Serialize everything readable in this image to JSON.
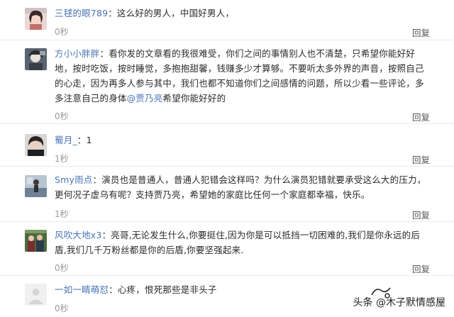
{
  "comments": [
    {
      "username": "三毬的眼789",
      "colon": "：",
      "text": "这么好的男人，中国好男人，",
      "time": "0秒",
      "reply": "回复",
      "avatar_icon": "avatar-girl-icon"
    },
    {
      "username": "方小小胖胖",
      "colon": "：",
      "text": "看你发的文章看的我很难受，你们之间的事情别人也不清楚，只希望你能好好地，按时吃饭，按时睡觉，多抱抱甜馨，钱赚多少才算够。不要听太多外界的声音，按照自己的心走，因为再多人参与其中，我们也都不知道你们之间感情的问题，所以少看一些评论，多多注意自己的身体",
      "mention": "@贾乃亮",
      "text_after": "希望你能好好的",
      "time": "0秒",
      "reply": "回复",
      "avatar_icon": "avatar-anime-icon"
    },
    {
      "username": "蜀月_",
      "colon": "：",
      "text": "1",
      "time": "1秒",
      "reply": "回复",
      "avatar_icon": "avatar-photo-icon"
    },
    {
      "username": "Smy雨点",
      "colon": "：",
      "text": "演员也是普通人，普通人犯错会这样吗？为什么演员犯错就要承受这么大的压力，更何况子虚乌有呢？支持贾乃亮，希望她的家庭比任何一个家庭都幸福，快乐。",
      "time": "1秒",
      "reply": "回复",
      "avatar_icon": "avatar-figure-icon"
    },
    {
      "username": "风吹大地x3",
      "colon": "：",
      "text": "亮哥,无论发生什么,你要挺住,因为你是可以抵挡一切困难的,我们是你永远的后盾,我们几千万粉丝都是你的后盾,你要坚强起来.",
      "time": "0秒",
      "reply": "回复",
      "avatar_icon": "avatar-group-icon"
    },
    {
      "username": "一如一睛萌怼",
      "colon": "：",
      "text": "心疼，恨死那些是非头子",
      "time": "0秒",
      "reply": "回复",
      "avatar_icon": "avatar-blank-icon"
    }
  ],
  "watermark": {
    "text": "头条 @木子默情感屋"
  }
}
